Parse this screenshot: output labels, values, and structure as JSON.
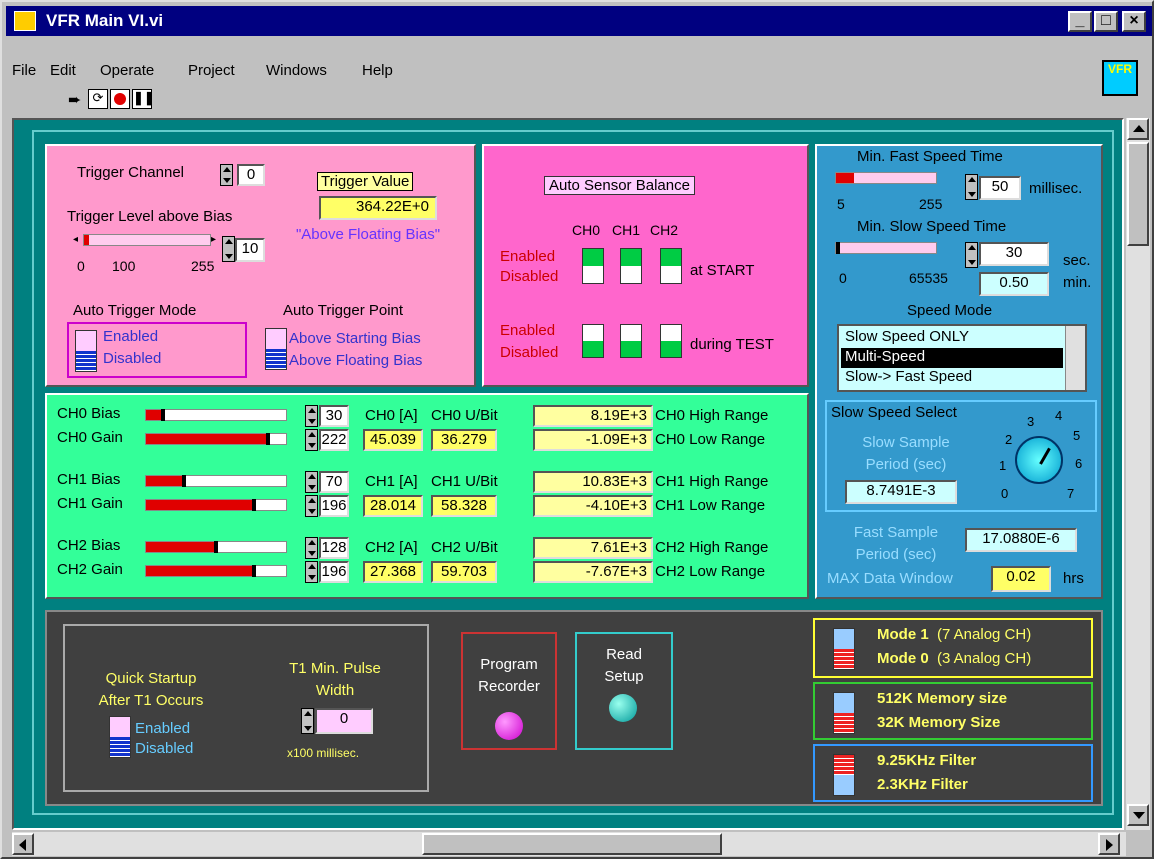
{
  "window": {
    "title": "VFR Main VI.vi",
    "min": "_",
    "max": "□",
    "close": "×"
  },
  "menu": {
    "file": "File",
    "edit": "Edit",
    "operate": "Operate",
    "project": "Project",
    "windows": "Windows",
    "help": "Help"
  },
  "toolbar": {
    "run_icon": "run-arrow-icon",
    "continuous_icon": "continuous-run-icon",
    "abort_icon": "abort-icon",
    "pause_icon": "pause-icon"
  },
  "vfr_icon": "VFR",
  "trigger": {
    "channel_label": "Trigger Channel",
    "channel_value": "0",
    "level_label": "Trigger Level above Bias",
    "level_ticks": [
      "0",
      "100",
      "255"
    ],
    "level_value": "10",
    "level_fraction": 0.04,
    "value_label": "Trigger Value",
    "value": "364.22E+0",
    "floating_note": "\"Above Floating Bias\"",
    "auto_mode_label": "Auto Trigger Mode",
    "auto_mode_enabled": "Enabled",
    "auto_mode_disabled": "Disabled",
    "auto_point_label": "Auto Trigger Point",
    "auto_point_starting": "Above Starting Bias",
    "auto_point_floating": "Above Floating Bias"
  },
  "balance": {
    "title": "Auto Sensor Balance",
    "channels": [
      "CH0",
      "CH1",
      "CH2"
    ],
    "enabled": "Enabled",
    "disabled": "Disabled",
    "at_start": "at START",
    "during_test": "during TEST"
  },
  "speed": {
    "fast_label": "Min. Fast Speed Time",
    "fast_value": "50",
    "fast_unit": "millisec.",
    "fast_ticks": [
      "5",
      "255"
    ],
    "fast_fraction": 0.18,
    "slow_label": "Min. Slow Speed Time",
    "slow_value": "30",
    "slow_unit": "sec.",
    "slow_ticks": [
      "0",
      "65535"
    ],
    "slow_min_value": "0.50",
    "slow_min_unit": "min.",
    "mode_label": "Speed Mode",
    "mode_options": [
      "Slow Speed ONLY",
      "Multi-Speed",
      "Slow-> Fast Speed"
    ],
    "mode_selected": "Multi-Speed",
    "select_label": "Slow Speed Select",
    "sample_label": "Slow Sample Period (sec)",
    "sample_value": "8.7491E-3",
    "dial_ticks": [
      "0",
      "1",
      "2",
      "3",
      "4",
      "5",
      "6",
      "7"
    ],
    "fast_sample_label": "Fast Sample Period (sec)",
    "fast_sample_value": "17.0880E-6",
    "max_window_label": "MAX Data Window",
    "max_window_value": "0.02",
    "max_window_unit": "hrs"
  },
  "channels": [
    {
      "bias_label": "CH0 Bias",
      "bias": "30",
      "bias_fraction": 0.12,
      "gain_label": "CH0 Gain",
      "gain": "222",
      "gain_fraction": 0.87,
      "a_label": "CH0 [A]",
      "ubit_label": "CH0 U/Bit",
      "a_value": "45.039",
      "ubit_value": "36.279",
      "high": "8.19E+3",
      "high_label": "CH0 High Range",
      "low": "-1.09E+3",
      "low_label": "CH0 Low Range"
    },
    {
      "bias_label": "CH1 Bias",
      "bias": "70",
      "bias_fraction": 0.27,
      "gain_label": "CH1 Gain",
      "gain": "196",
      "gain_fraction": 0.77,
      "a_label": "CH1 [A]",
      "ubit_label": "CH1 U/Bit",
      "a_value": "28.014",
      "ubit_value": "58.328",
      "high": "10.83E+3",
      "high_label": "CH1 High Range",
      "low": "-4.10E+3",
      "low_label": "CH1 Low Range"
    },
    {
      "bias_label": "CH2 Bias",
      "bias": "128",
      "bias_fraction": 0.5,
      "gain_label": "CH2 Gain",
      "gain": "196",
      "gain_fraction": 0.77,
      "a_label": "CH2 [A]",
      "ubit_label": "CH2 U/Bit",
      "a_value": "27.368",
      "ubit_value": "59.703",
      "high": "7.61E+3",
      "high_label": "CH2 High Range",
      "low": "-7.67E+3",
      "low_label": "CH2 Low Range"
    }
  ],
  "bottom": {
    "quick_label": "Quick Startup After T1 Occurs",
    "enabled": "Enabled",
    "disabled": "Disabled",
    "t1_label": "T1  Min. Pulse Width",
    "t1_value": "0",
    "t1_unit": "x100 millisec.",
    "program_label": "Program Recorder",
    "read_label": "Read Setup",
    "mode1": "Mode 1",
    "mode1_note": "(7 Analog CH)",
    "mode0": "Mode 0",
    "mode0_note": "(3 Analog CH)",
    "mem512": "512K Memory size",
    "mem32": "32K Memory Size",
    "filter1": "9.25KHz Filter",
    "filter2": "2.3KHz Filter"
  },
  "colors": {
    "teal": "#008080",
    "pink": "#ff99cc",
    "magenta": "#ff66cc",
    "blue_panel": "#3399cc",
    "green_panel": "#33ff99",
    "dark": "#404040"
  }
}
